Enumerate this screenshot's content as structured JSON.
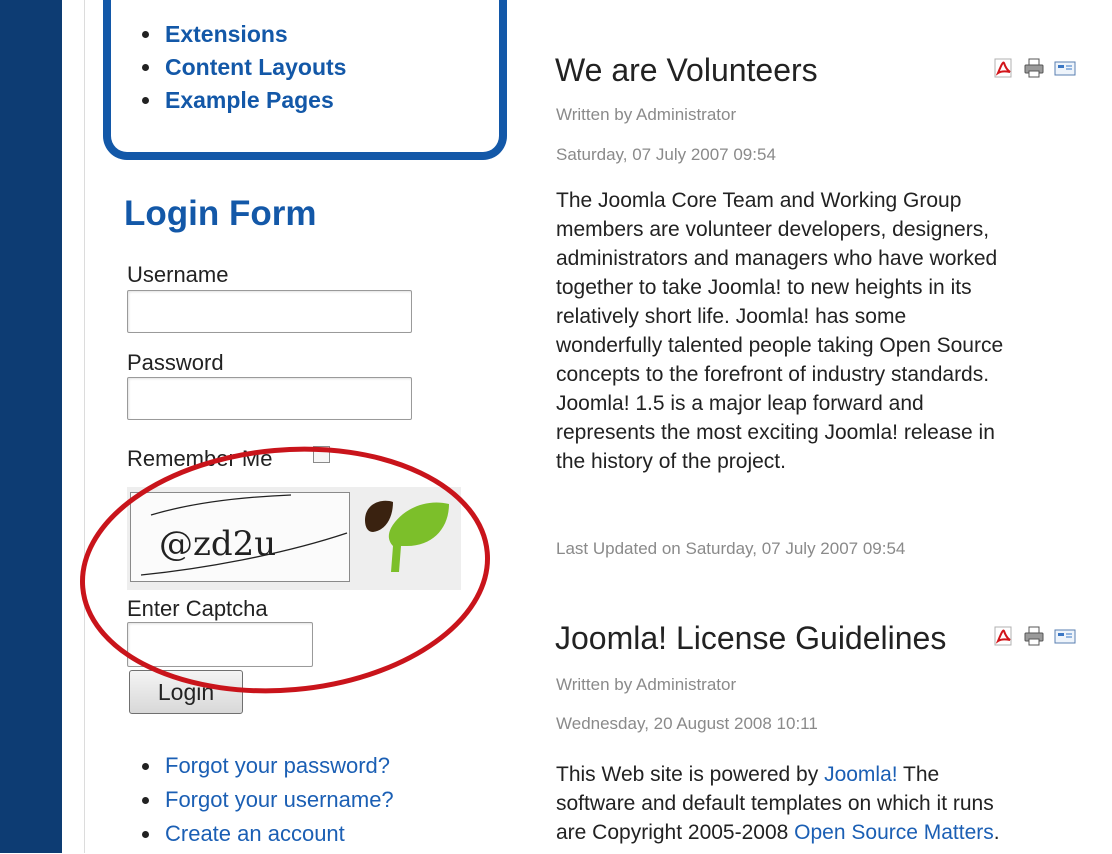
{
  "main_menu": {
    "items": [
      "Extensions",
      "Content Layouts",
      "Example Pages"
    ]
  },
  "login": {
    "title": "Login Form",
    "username_label": "Username",
    "password_label": "Password",
    "remember_label": "Remember Me",
    "captcha_text": "@zd2u",
    "captcha_label": "Enter Captcha",
    "button_label": "Login",
    "links": [
      "Forgot your password?",
      "Forgot your username?",
      "Create an account"
    ]
  },
  "articles": [
    {
      "title": "We are Volunteers",
      "author": "Written by Administrator",
      "date": "Saturday, 07 July 2007 09:54",
      "body": [
        "The Joomla Core Team and Working Group",
        "members are volunteer developers, designers,",
        "administrators and managers who have worked",
        "together to take Joomla! to new heights in its",
        "relatively short life. Joomla! has some",
        "wonderfully talented people taking Open Source",
        "concepts to the forefront of industry standards.",
        "Joomla! 1.5 is a major leap forward and",
        "represents the most exciting Joomla! release in",
        "the history of the project."
      ],
      "updated": "Last Updated on Saturday, 07 July 2007 09:54"
    },
    {
      "title": "Joomla! License Guidelines",
      "author": "Written by Administrator",
      "date": "Wednesday, 20 August 2008 10:11",
      "body_p1": "This Web site is powered by ",
      "body_link1": "Joomla!",
      "body_p2": " The",
      "body_line2": "software and default templates on which it runs",
      "body_p3": "are Copyright 2005-2008 ",
      "body_link2": "Open Source Matters",
      "body_p4": "."
    }
  ],
  "icons": [
    "pdf-icon",
    "print-icon",
    "email-icon"
  ],
  "colors": {
    "sidebar_strip": "#0d3c73",
    "heading_blue": "#1358a8",
    "link_blue": "#1b5fb4",
    "highlight_red": "#c9141b",
    "leaf_green": "#7cbf2a",
    "leaf_brown": "#3a2210"
  }
}
